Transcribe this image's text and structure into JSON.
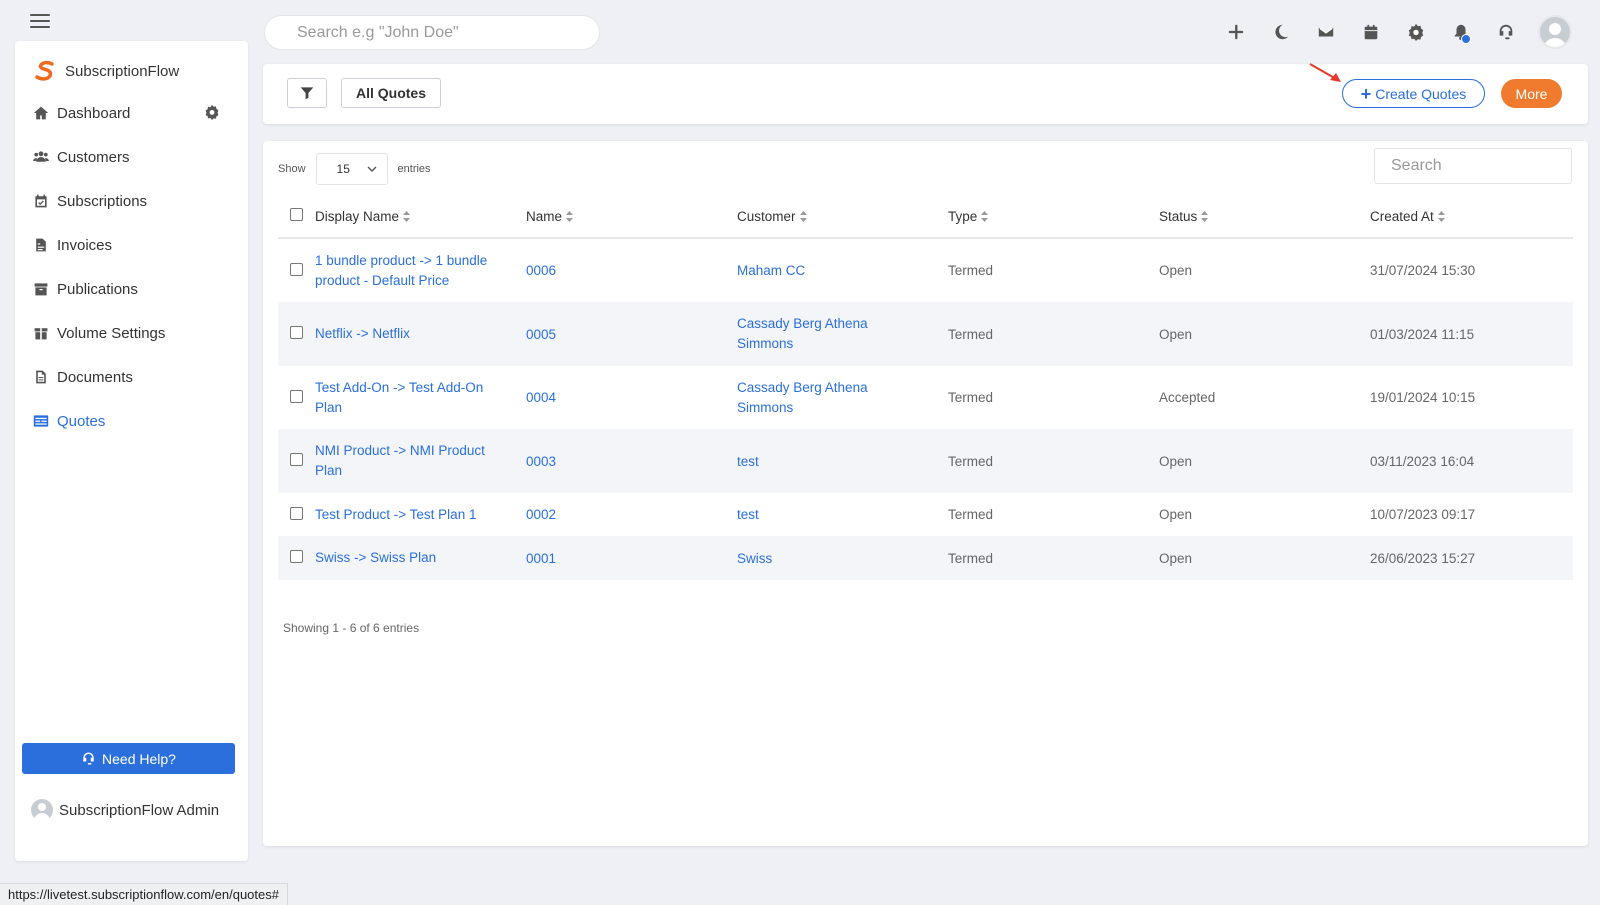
{
  "top": {
    "search_placeholder": "Search e.g \"John Doe\"",
    "icons": [
      "plus-icon",
      "moon-icon",
      "mail-icon",
      "calendar-icon",
      "gear-icon",
      "bell-icon",
      "headset-icon",
      "avatar"
    ]
  },
  "sidebar": {
    "brand": "SubscriptionFlow",
    "items": [
      {
        "label": "Dashboard",
        "icon": "home-icon"
      },
      {
        "label": "Customers",
        "icon": "users-icon"
      },
      {
        "label": "Subscriptions",
        "icon": "calendar-check-icon"
      },
      {
        "label": "Invoices",
        "icon": "invoice-icon"
      },
      {
        "label": "Publications",
        "icon": "archive-icon"
      },
      {
        "label": "Volume Settings",
        "icon": "box-icon"
      },
      {
        "label": "Documents",
        "icon": "document-icon"
      },
      {
        "label": "Quotes",
        "icon": "quotes-icon",
        "active": true
      }
    ],
    "help_label": "Need Help?",
    "admin_name": "SubscriptionFlow Admin"
  },
  "toolbar": {
    "all_quotes_label": "All Quotes",
    "create_label": "Create Quotes",
    "more_label": "More"
  },
  "table": {
    "show_label": "Show",
    "entries_value": "15",
    "entries_label": "entries",
    "search_placeholder": "Search",
    "columns": [
      "Display Name",
      "Name",
      "Customer",
      "Type",
      "Status",
      "Created At"
    ],
    "rows": [
      {
        "display": "1 bundle product -> 1 bundle product - Default Price",
        "name": "0006",
        "customer": "Maham CC",
        "type": "Termed",
        "status": "Open",
        "created": "31/07/2024 15:30"
      },
      {
        "display": "Netflix -> Netflix",
        "name": "0005",
        "customer": "Cassady Berg Athena Simmons",
        "type": "Termed",
        "status": "Open",
        "created": "01/03/2024 11:15"
      },
      {
        "display": "Test Add-On -> Test Add-On Plan",
        "name": "0004",
        "customer": "Cassady Berg Athena Simmons",
        "type": "Termed",
        "status": "Accepted",
        "created": "19/01/2024 10:15"
      },
      {
        "display": "NMI Product -> NMI Product Plan",
        "name": "0003",
        "customer": "test",
        "type": "Termed",
        "status": "Open",
        "created": "03/11/2023 16:04"
      },
      {
        "display": "Test Product -> Test Plan 1",
        "name": "0002",
        "customer": "test",
        "type": "Termed",
        "status": "Open",
        "created": "10/07/2023 09:17"
      },
      {
        "display": "Swiss -> Swiss Plan",
        "name": "0001",
        "customer": "Swiss",
        "type": "Termed",
        "status": "Open",
        "created": "26/06/2023 15:27"
      }
    ],
    "showing_text": "Showing 1 - 6 of 6 entries"
  },
  "status_bar": {
    "url": "https://livetest.subscriptionflow.com/en/quotes#"
  },
  "colors": {
    "accent": "#2a6fdb",
    "more_button": "#f07a2e",
    "annotation_arrow": "#e8382b"
  }
}
